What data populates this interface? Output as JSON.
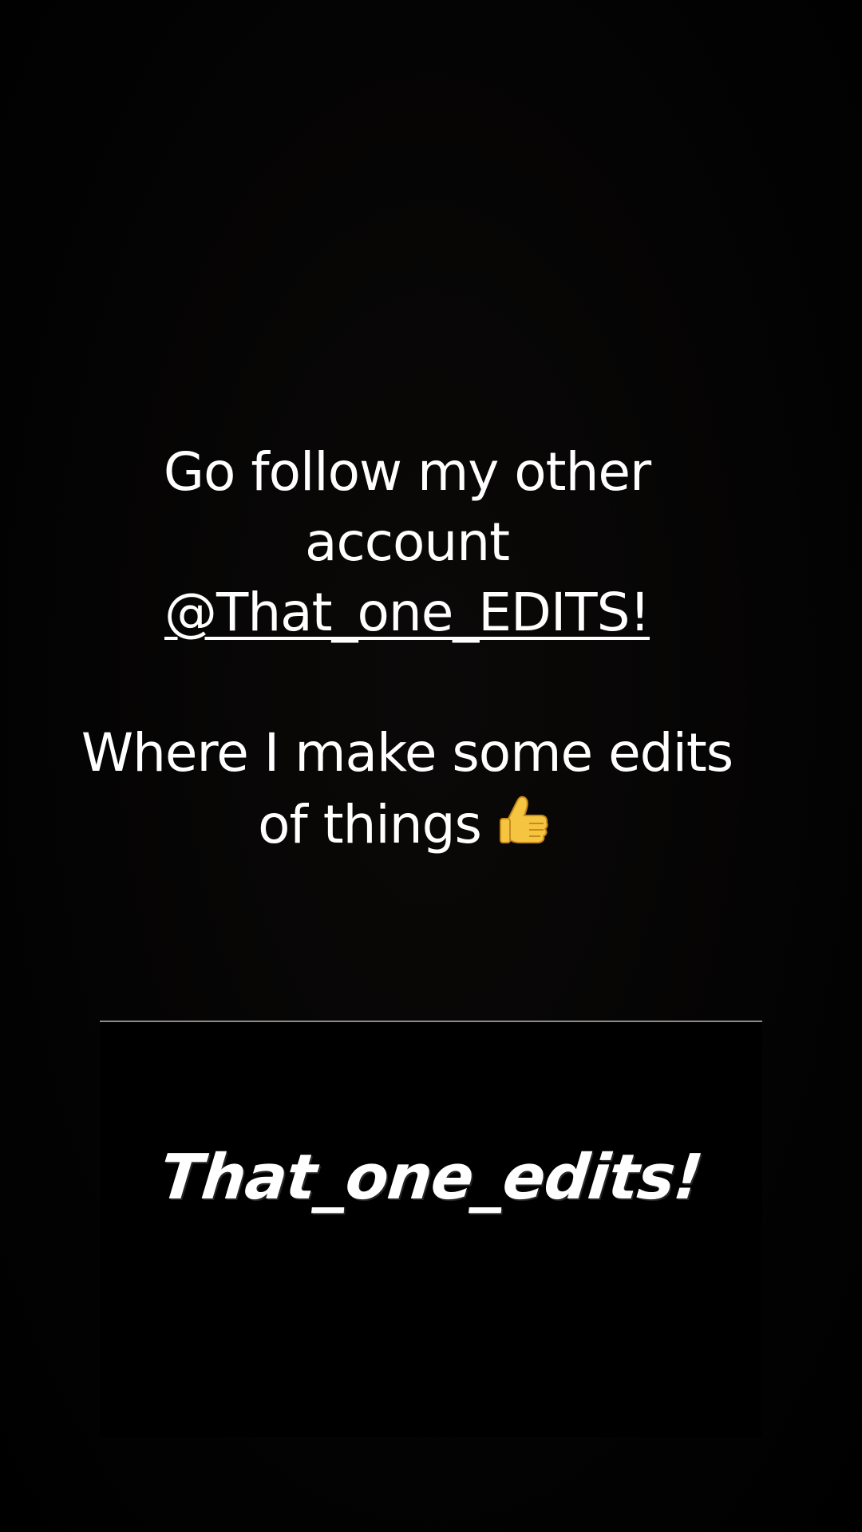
{
  "story": {
    "line1": "Go follow my other",
    "line2": "account",
    "handle": "@That_one_EDITS!",
    "line3": "Where I make some edits",
    "line4": "of things",
    "emoji_icon": "thumbs-up-icon"
  },
  "embedded_post": {
    "title": "That_one_edits!"
  },
  "colors": {
    "background": "#000000",
    "text": "#ffffff",
    "divider": "#8c8c8c",
    "emoji": "#f5c542"
  }
}
